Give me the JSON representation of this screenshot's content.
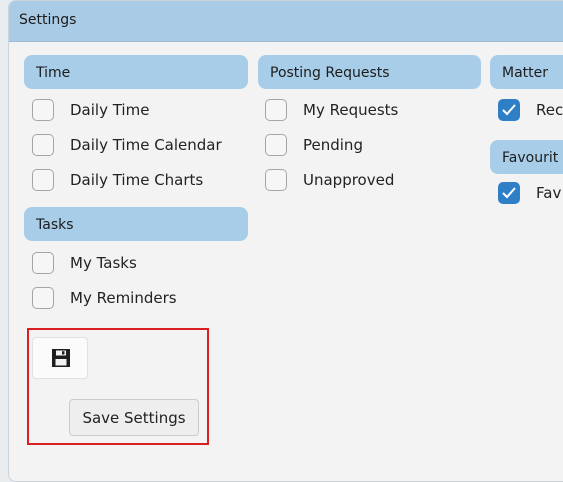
{
  "window": {
    "title": "Settings"
  },
  "groups": {
    "time": {
      "header": "Time",
      "items": [
        {
          "label": "Daily Time",
          "checked": false
        },
        {
          "label": "Daily Time Calendar",
          "checked": false
        },
        {
          "label": "Daily Time Charts",
          "checked": false
        }
      ]
    },
    "posting_requests": {
      "header": "Posting Requests",
      "items": [
        {
          "label": "My Requests",
          "checked": false
        },
        {
          "label": "Pending",
          "checked": false
        },
        {
          "label": "Unapproved",
          "checked": false
        }
      ]
    },
    "matter": {
      "header": "Matter",
      "items": [
        {
          "label": "Rec",
          "checked": true
        }
      ]
    },
    "favourites": {
      "header": "Favourit",
      "items": [
        {
          "label": "Fav",
          "checked": true
        }
      ]
    },
    "tasks": {
      "header": "Tasks",
      "items": [
        {
          "label": "My Tasks",
          "checked": false
        },
        {
          "label": "My Reminders",
          "checked": false
        }
      ]
    }
  },
  "actions": {
    "save_icon": "floppy-disk-icon",
    "save_label": "Save Settings"
  },
  "colors": {
    "title_bar": "#a9cbe6",
    "group_header": "#a7cde9",
    "checkbox_checked": "#2f7fc6",
    "highlight": "#d9201e"
  }
}
